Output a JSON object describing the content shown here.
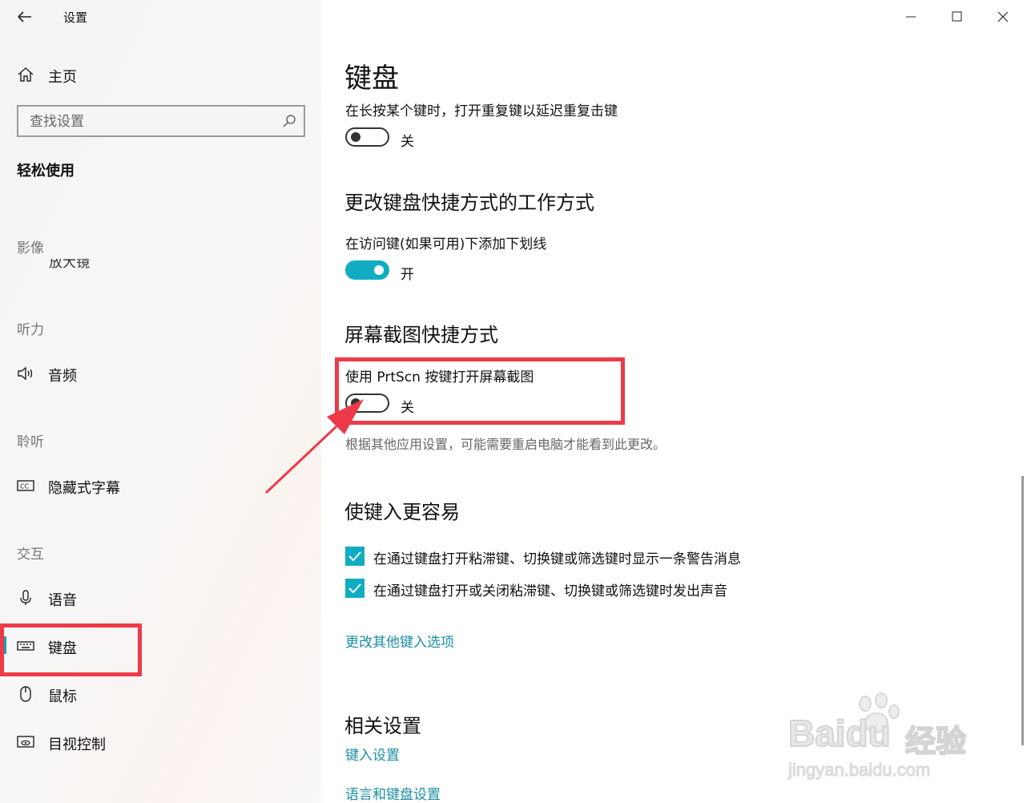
{
  "window": {
    "title": "设置"
  },
  "sidebar": {
    "home_label": "主页",
    "search_placeholder": "查找设置",
    "category": "轻松使用",
    "sections": {
      "vision": "影像",
      "hearing": "听力",
      "listening": "聆听",
      "interaction": "交互"
    },
    "vision_clipped_item": "放大镜",
    "items": {
      "audio": "音频",
      "captions": "隐藏式字幕",
      "speech": "语音",
      "keyboard": "键盘",
      "mouse": "鼠标",
      "eye_control": "目视控制"
    },
    "selected_item": "keyboard"
  },
  "main": {
    "page_title": "键盘",
    "repeat_keys": {
      "label": "在长按某个键时，打开重复键以延迟重复击键",
      "state": "关",
      "on": false
    },
    "shortcuts_heading": "更改键盘快捷方式的工作方式",
    "underline_access_keys": {
      "label": "在访问键(如果可用)下添加下划线",
      "state": "开",
      "on": true
    },
    "printscreen_heading": "屏幕截图快捷方式",
    "printscreen": {
      "label": "使用 PrtScn 按键打开屏幕截图",
      "state": "关",
      "on": false,
      "hint": "根据其他应用设置，可能需要重启电脑才能看到此更改。"
    },
    "easier_typing_heading": "使键入更容易",
    "checkboxes": [
      {
        "label": "在通过键盘打开粘滞键、切换键或筛选键时显示一条警告消息",
        "checked": true
      },
      {
        "label": "在通过键盘打开或关闭粘滞键、切换键或筛选键时发出声音",
        "checked": true
      }
    ],
    "other_typing_link": "更改其他键入选项",
    "related_heading": "相关设置",
    "related_links": [
      "键入设置",
      "语言和键盘设置"
    ]
  },
  "watermark": {
    "brand": "Baidu",
    "brand_cn": "经验",
    "url": "jingyan.baidu.com"
  },
  "colors": {
    "accent": "#10adc2",
    "link": "#1a8fa5",
    "annotation": "#ee3a48"
  }
}
